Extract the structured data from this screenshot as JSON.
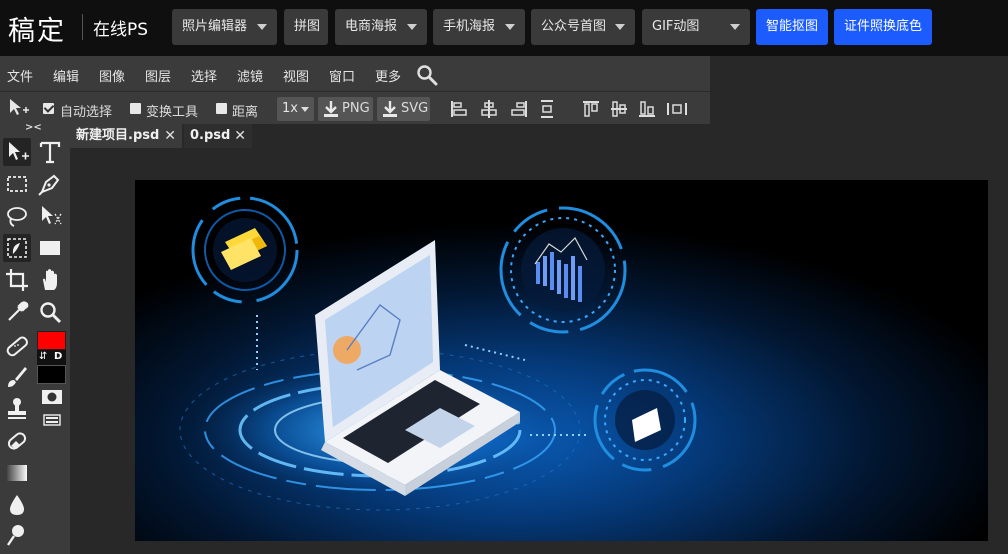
{
  "app": {
    "logo": "稿定",
    "subtitle": "在线PS"
  },
  "topnav": [
    {
      "label": "照片编辑器",
      "dropdown": true
    },
    {
      "label": "拼图",
      "dropdown": false
    },
    {
      "label": "电商海报",
      "dropdown": true
    },
    {
      "label": "手机海报",
      "dropdown": true
    },
    {
      "label": "公众号首图",
      "dropdown": true
    },
    {
      "label": "GIF动图",
      "dropdown": true
    },
    {
      "label": "智能抠图",
      "highlight": true
    },
    {
      "label": "证件照换底色",
      "highlight": true
    }
  ],
  "menu": [
    "文件",
    "编辑",
    "图像",
    "图层",
    "选择",
    "滤镜",
    "视图",
    "窗口",
    "更多"
  ],
  "options": {
    "auto_select": {
      "label": "自动选择",
      "checked": true
    },
    "transform_tools": {
      "label": "变换工具",
      "checked": false
    },
    "distance": {
      "label": "距离",
      "checked": false
    },
    "scale": "1x",
    "export_png": "PNG",
    "export_svg": "SVG"
  },
  "tabs": [
    {
      "label": "新建项目.psd",
      "close": "✕"
    },
    {
      "label": "0.psd",
      "close": "✕"
    }
  ],
  "toolbox": {
    "collapse_label": "><",
    "foreground_color": "#ff0000",
    "background_color": "#000000",
    "swap_label": "⇵",
    "default_label": "D"
  },
  "colors": {
    "accent": "#1c5cff",
    "panel": "#3b3b3b",
    "topbar": "#0f0f0f",
    "workspace": "#282828",
    "glow": "#1e90ff",
    "coin": "#ffd83a"
  }
}
